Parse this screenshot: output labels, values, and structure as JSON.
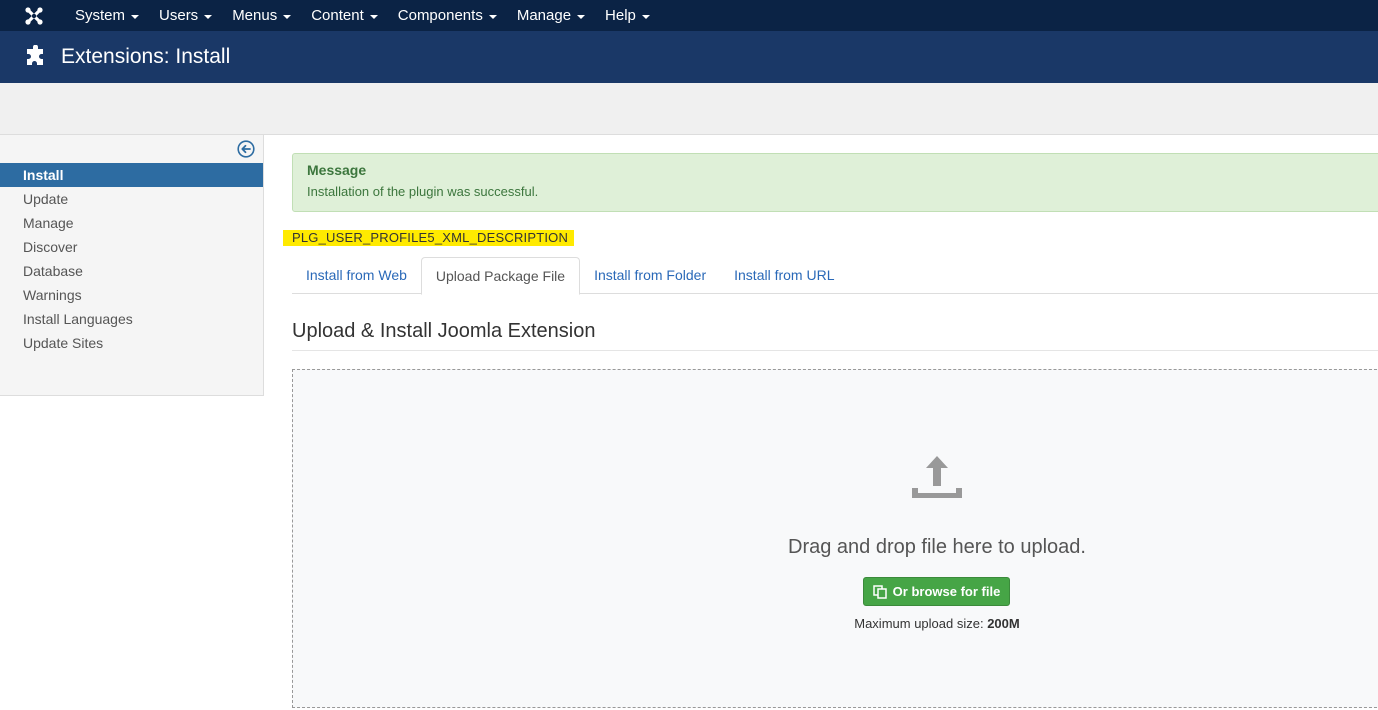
{
  "nav": {
    "items": [
      {
        "label": "System"
      },
      {
        "label": "Users"
      },
      {
        "label": "Menus"
      },
      {
        "label": "Content"
      },
      {
        "label": "Components"
      },
      {
        "label": "Manage"
      },
      {
        "label": "Help"
      }
    ]
  },
  "header": {
    "title": "Extensions: Install"
  },
  "sidebar": {
    "items": [
      {
        "label": "Install"
      },
      {
        "label": "Update"
      },
      {
        "label": "Manage"
      },
      {
        "label": "Discover"
      },
      {
        "label": "Database"
      },
      {
        "label": "Warnings"
      },
      {
        "label": "Install Languages"
      },
      {
        "label": "Update Sites"
      }
    ],
    "active_index": 0
  },
  "alert": {
    "heading": "Message",
    "text": "Installation of the plugin was successful."
  },
  "xml_description": "PLG_USER_PROFILE5_XML_DESCRIPTION",
  "tabs": [
    {
      "label": "Install from Web"
    },
    {
      "label": "Upload Package File"
    },
    {
      "label": "Install from Folder"
    },
    {
      "label": "Install from URL"
    }
  ],
  "active_tab": 1,
  "section_title": "Upload & Install Joomla Extension",
  "dropzone": {
    "text": "Drag and drop file here to upload.",
    "browse_label": "Or browse for file",
    "max_size_label": "Maximum upload size:",
    "max_size_value": "200M"
  },
  "colors": {
    "navbar": "#0b2345",
    "header": "#1a3867",
    "active_sidebar": "#2d6ca2",
    "success_bg": "#dff0d8",
    "highlight": "#ffea00",
    "browse_button": "#46a546"
  },
  "icons": {
    "logo": "joomla-logo-icon",
    "header": "puzzle-icon",
    "collapse": "circle-arrow-left-icon",
    "upload": "upload-icon",
    "browse": "copy-icon"
  }
}
